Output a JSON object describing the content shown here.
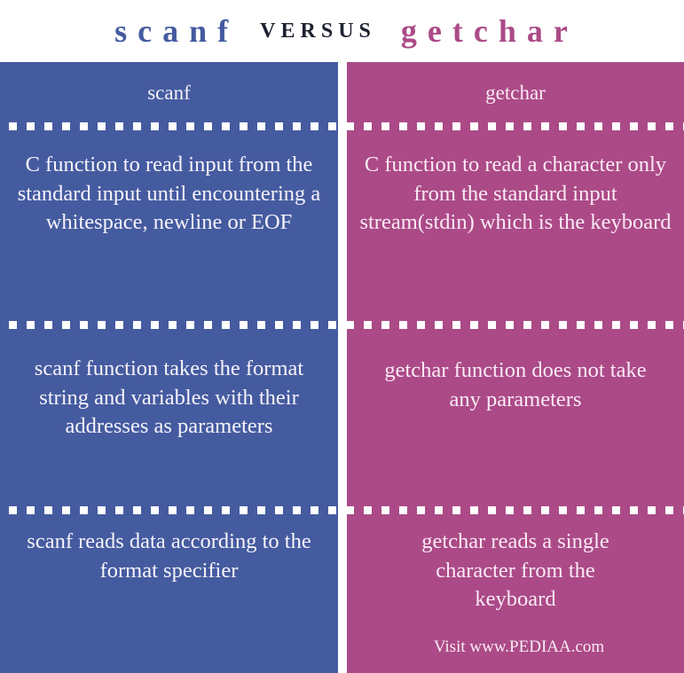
{
  "title": {
    "left": "scanf",
    "middle": "VERSUS",
    "right": "getchar"
  },
  "colors": {
    "left_panel": "#455ba0",
    "right_panel": "#ab4a87",
    "versus_text": "#1e2230"
  },
  "columns": [
    {
      "header": "scanf",
      "rows": [
        "C function to read input from the standard input until encountering a whitespace, newline or EOF",
        "scanf function takes the format string and variables with their addresses as parameters",
        "scanf reads data according to the format specifier"
      ]
    },
    {
      "header": "getchar",
      "rows": [
        "C function to read a character only from the standard input stream(stdin) which is the keyboard",
        "getchar function does not take any parameters",
        "getchar reads a single character from the keyboard"
      ]
    }
  ],
  "footer": "Visit www.PEDIAA.com"
}
